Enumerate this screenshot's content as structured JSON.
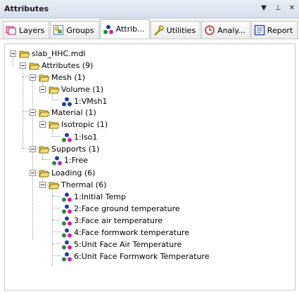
{
  "panel": {
    "title": "Attributes",
    "controls": [
      "▼",
      "⊥",
      "✕"
    ]
  },
  "tabs": [
    {
      "label": "Layers",
      "icon": "layers-icon"
    },
    {
      "label": "Groups",
      "icon": "groups-icon"
    },
    {
      "label": "Attrib...",
      "icon": "attributes-icon",
      "active": true
    },
    {
      "label": "Utilities",
      "icon": "wrench-icon"
    },
    {
      "label": "Analy...",
      "icon": "analysis-icon"
    },
    {
      "label": "Report",
      "icon": "report-icon"
    }
  ],
  "tree": {
    "root": "slab_HHC.mdl",
    "attributes": "Attributes (9)",
    "mesh": "Mesh (1)",
    "volume": "Volume (1)",
    "vmsh": "1:VMsh1",
    "material": "Material (1)",
    "isotropic": "Isotropic (1)",
    "iso": "1:Iso1",
    "supports": "Supports (1)",
    "free": "1:Free",
    "loading": "Loading (6)",
    "thermal": "Thermal (6)",
    "thermal_items": [
      "1:Initial Temp",
      "2:Face ground temperature",
      "3:Face air temperature",
      "4:Face formwork temperature",
      "5:Unit Face Air Temperature",
      "6:Unit Face Formwork Temperature"
    ]
  },
  "colors": {
    "folder": "#e8c84a",
    "node_blue": "#1e3fa8",
    "node_magenta": "#d21eb4",
    "node_green": "#1f8f2c"
  }
}
